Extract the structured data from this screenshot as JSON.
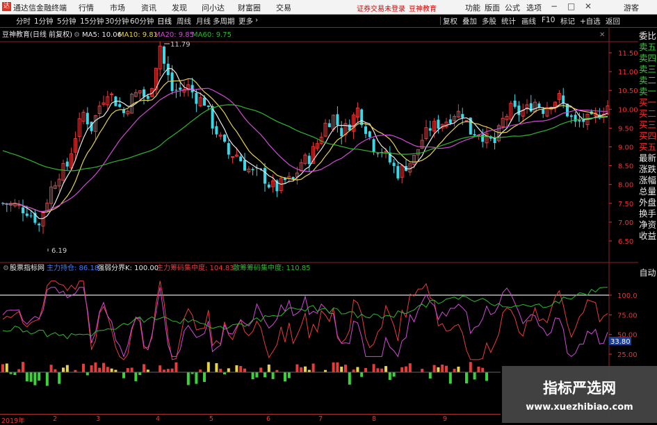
{
  "titlebar": {
    "logo": "达",
    "app_title": "通达信金融终端",
    "menus": [
      "行情",
      "市场",
      "资讯",
      "发现",
      "问小达",
      "财富圈",
      "交易"
    ],
    "warning": "证券交易未登录",
    "brand": "豆神教育",
    "right_menus": [
      "功能",
      "版面",
      "公式",
      "选项"
    ],
    "win_min": "−",
    "win_max": "□",
    "win_close": "✕",
    "guest": "游客"
  },
  "toolbar": {
    "timeframes": [
      "分时",
      "1分钟",
      "5分钟",
      "15分钟",
      "30分钟",
      "60分钟",
      "日线",
      "周线",
      "月线",
      "多周期",
      "更多"
    ],
    "more_arrow": "›",
    "right_buttons": [
      "复权",
      "叠加",
      "多股",
      "统计",
      "画线",
      "F10",
      "标记",
      "+自选",
      "返回"
    ]
  },
  "main_chart": {
    "title": "豆神教育(日线 前复权)",
    "legend": [
      {
        "label": "MA5: 10.06",
        "color": "#e8e8e8"
      },
      {
        "label": "MA10: 9.81",
        "color": "#e8d24a"
      },
      {
        "label": "MA20: 9.85",
        "color": "#d24ad8"
      },
      {
        "label": "MA60: 9.75",
        "color": "#2eb82e"
      }
    ],
    "price_ticks": [
      "11.50",
      "11.00",
      "10.50",
      "10.00",
      "9.50",
      "9.00",
      "8.50",
      "8.00",
      "7.50",
      "7.00",
      "6.50"
    ],
    "high_label": "11.79",
    "low_label": "6.19",
    "icon_settings": "⚙",
    "icon_close": "✕"
  },
  "indicator": {
    "title": "股票指标网",
    "legend": [
      {
        "label": "主力持仓: 86.18",
        "color": "#3a7cff"
      },
      {
        "label": "强弱分界K: 100.00",
        "color": "#e8e8e8"
      },
      {
        "label": "主力筹码集中度: 104.83",
        "color": "#e63c3c"
      },
      {
        "label": "散筹筹码集中度: 110.85",
        "color": "#2eb82e"
      }
    ],
    "ticks": [
      "100.0",
      "75.00",
      "50.00",
      "25.00"
    ],
    "current_value": "33.80"
  },
  "sidebar": {
    "items": [
      "委比",
      "卖五",
      "卖四",
      "卖三",
      "卖二",
      "卖一",
      "买一",
      "买二",
      "买三",
      "买四",
      "买五",
      "最新",
      "涨跌",
      "涨幅",
      "总量",
      "外盘",
      "换手",
      "净资",
      "收益"
    ],
    "auto": "自动"
  },
  "time_axis": {
    "labels": [
      "2019年",
      "2",
      "3",
      "4",
      "5",
      "6",
      "7",
      "8",
      "9"
    ]
  },
  "watermark": {
    "title": "指标严选网",
    "url": "www.xuezhibiao.com"
  },
  "colors": {
    "up": "#e63c3c",
    "down": "#3cd8e8",
    "ma5": "#e8e8e8",
    "ma10": "#e8d24a",
    "ma20": "#d24ad8",
    "ma60": "#2eb82e"
  },
  "chart_data": {
    "type": "candlestick",
    "title": "豆神教育(日线 前复权)",
    "x_labels": [
      "2019年",
      "2",
      "3",
      "4",
      "5",
      "6",
      "7",
      "8",
      "9"
    ],
    "y_ticks": [
      11.5,
      11.0,
      10.5,
      10.0,
      9.5,
      9.0,
      8.5,
      8.0,
      7.5,
      7.0,
      6.5
    ],
    "ylim": [
      6.0,
      12.0
    ],
    "annotations": {
      "high": 11.79,
      "low": 6.19
    },
    "close_path": [
      [
        0,
        7.5
      ],
      [
        3,
        7.45
      ],
      [
        6,
        7.3
      ],
      [
        8,
        7.1
      ],
      [
        9,
        6.9
      ],
      [
        10,
        7.3
      ],
      [
        12,
        7.9
      ],
      [
        14,
        8.3
      ],
      [
        16,
        8.5
      ],
      [
        18,
        9.3
      ],
      [
        20,
        9.9
      ],
      [
        22,
        9.5
      ],
      [
        24,
        10.1
      ],
      [
        26,
        10.5
      ],
      [
        28,
        10.2
      ],
      [
        30,
        9.9
      ],
      [
        32,
        10.3
      ],
      [
        34,
        10.5
      ],
      [
        36,
        10.2
      ],
      [
        38,
        11.2
      ],
      [
        39,
        11.7
      ],
      [
        40,
        11.2
      ],
      [
        42,
        10.5
      ],
      [
        44,
        10.5
      ],
      [
        46,
        10.6
      ],
      [
        48,
        10.3
      ],
      [
        50,
        10.2
      ],
      [
        52,
        9.6
      ],
      [
        54,
        9.2
      ],
      [
        56,
        8.8
      ],
      [
        58,
        8.8
      ],
      [
        60,
        8.5
      ],
      [
        62,
        8.3
      ],
      [
        64,
        8.3
      ],
      [
        66,
        8.0
      ],
      [
        68,
        7.9
      ],
      [
        70,
        8.1
      ],
      [
        72,
        8.1
      ],
      [
        74,
        8.6
      ],
      [
        76,
        8.7
      ],
      [
        78,
        9.1
      ],
      [
        80,
        9.6
      ],
      [
        82,
        9.8
      ],
      [
        84,
        9.4
      ],
      [
        86,
        9.6
      ],
      [
        88,
        10.0
      ],
      [
        90,
        9.5
      ],
      [
        92,
        9.0
      ],
      [
        94,
        8.9
      ],
      [
        96,
        8.6
      ],
      [
        98,
        8.3
      ],
      [
        100,
        8.5
      ],
      [
        102,
        8.7
      ],
      [
        104,
        9.2
      ],
      [
        106,
        9.5
      ],
      [
        108,
        9.6
      ],
      [
        110,
        9.7
      ],
      [
        112,
        9.9
      ],
      [
        114,
        9.9
      ],
      [
        116,
        9.4
      ],
      [
        118,
        9.4
      ],
      [
        120,
        9.2
      ],
      [
        122,
        9.1
      ],
      [
        124,
        9.7
      ],
      [
        126,
        10.0
      ],
      [
        128,
        9.9
      ],
      [
        130,
        10.0
      ],
      [
        132,
        10.2
      ],
      [
        134,
        10.0
      ],
      [
        136,
        10.2
      ],
      [
        138,
        10.3
      ],
      [
        140,
        9.9
      ],
      [
        142,
        9.6
      ],
      [
        144,
        9.7
      ],
      [
        146,
        9.7
      ],
      [
        148,
        9.9
      ],
      [
        150,
        10.1
      ]
    ],
    "ma_endpoints": {
      "MA5": 10.06,
      "MA10": 9.81,
      "MA20": 9.85,
      "MA60": 9.75
    },
    "indicator": {
      "strong_weak_line": 100.0,
      "ylim": [
        0,
        125
      ],
      "ticks": [
        100,
        75,
        50,
        25
      ],
      "current": 33.8
    }
  }
}
